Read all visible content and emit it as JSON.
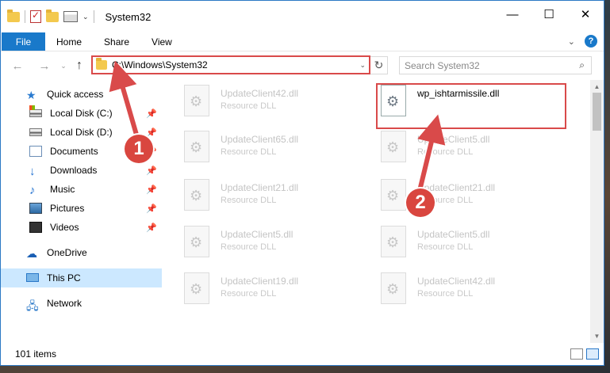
{
  "window": {
    "title": "System32",
    "minimize_icon": "—",
    "maximize_icon": "☐",
    "close_icon": "✕"
  },
  "ribbon": {
    "tabs": [
      "File",
      "Home",
      "Share",
      "View"
    ],
    "expand_icon": "⌄",
    "help_icon": "?"
  },
  "address": {
    "path": "C:\\Windows\\System32",
    "refresh_icon": "↻",
    "search_placeholder": "Search System32",
    "search_icon": "⌕"
  },
  "nav_glyphs": {
    "back": "←",
    "forward": "→",
    "recent": "⌄",
    "up": "↑",
    "quick_access": "★",
    "downloads": "↓",
    "music": "♪",
    "onedrive": "☁",
    "network": "🖧",
    "pin": "📌"
  },
  "sidebar": {
    "quick_access": "Quick access",
    "items": [
      {
        "label": "Local Disk (C:)",
        "pinned": true
      },
      {
        "label": "Local Disk (D:)",
        "pinned": true
      },
      {
        "label": "Documents",
        "pinned": true
      },
      {
        "label": "Downloads",
        "pinned": true
      },
      {
        "label": "Music",
        "pinned": true
      },
      {
        "label": "Pictures",
        "pinned": true
      },
      {
        "label": "Videos",
        "pinned": true
      }
    ],
    "onedrive": "OneDrive",
    "this_pc": "This PC",
    "network": "Network"
  },
  "files": [
    {
      "name": "UpdateClient42.dll",
      "type": "Resource DLL"
    },
    {
      "name": "wp_ishtarmissile.dll",
      "type": ""
    },
    {
      "name": "UpdateClient65.dll",
      "type": "Resource DLL"
    },
    {
      "name": "UpdateClient5.dll",
      "type": "Resource DLL"
    },
    {
      "name": "UpdateClient21.dll",
      "type": "Resource DLL"
    },
    {
      "name": "UpdateClient21.dll",
      "type": "Resource DLL"
    },
    {
      "name": "UpdateClient5.dll",
      "type": "Resource DLL"
    },
    {
      "name": "UpdateClient5.dll",
      "type": "Resource DLL"
    },
    {
      "name": "UpdateClient19.dll",
      "type": "Resource DLL"
    },
    {
      "name": "UpdateClient42.dll",
      "type": "Resource DLL"
    }
  ],
  "status": {
    "count": "101 items"
  },
  "markers": [
    "1",
    "2"
  ],
  "colors": {
    "accent": "#1979ca",
    "annotation": "#d94a4a",
    "selection": "#cce8ff"
  }
}
